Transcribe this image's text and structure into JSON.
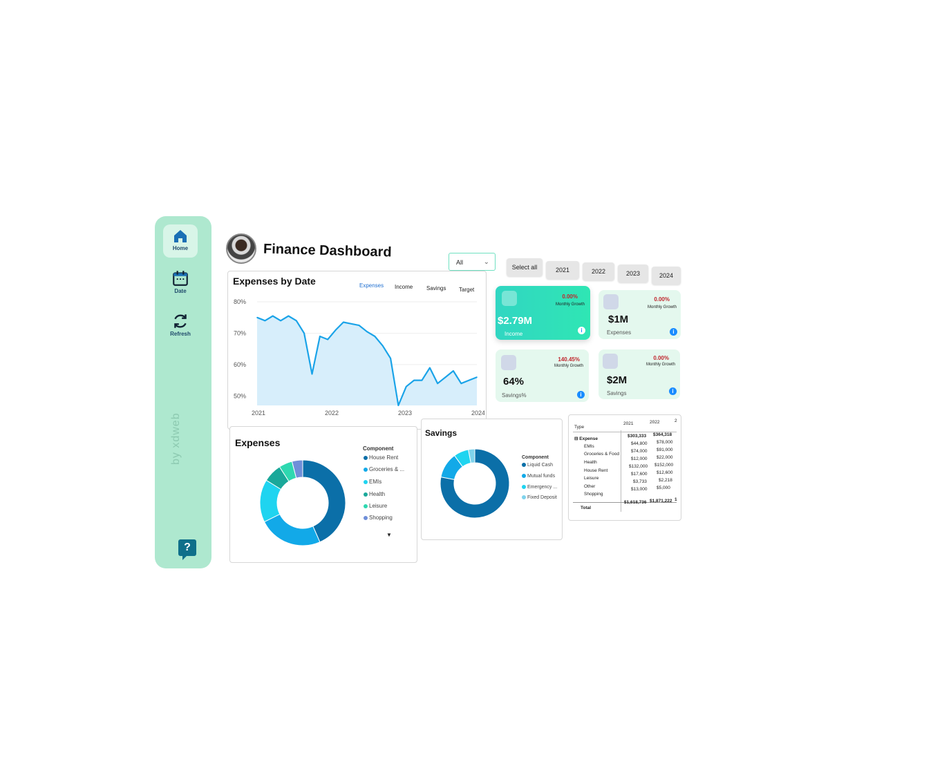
{
  "sidebar": {
    "items": [
      {
        "label": "Home"
      },
      {
        "label": "Date"
      },
      {
        "label": "Refresh"
      }
    ],
    "credit": "by xdweb",
    "help_label": "?"
  },
  "header": {
    "title": "Finance Dashboard",
    "dropdown_value": "All",
    "year_buttons": [
      "Select all",
      "2021",
      "2022",
      "2023",
      "2024"
    ]
  },
  "line_panel": {
    "title": "Expenses by Date",
    "tabs": [
      "Expenses",
      "Income",
      "Savings",
      "Target"
    ]
  },
  "kpis": [
    {
      "value": "$2.79M",
      "label": "Income",
      "growth": "0.00%",
      "growth_label": "Monthly Growth"
    },
    {
      "value": "$1M",
      "label": "Expenses",
      "growth": "0.00%",
      "growth_label": "Monthly Growth"
    },
    {
      "value": "64%",
      "label": "Savings%",
      "growth": "140.45%",
      "growth_label": "Monthly Growth"
    },
    {
      "value": "$2M",
      "label": "Savings",
      "growth": "0.00%",
      "growth_label": "Monthly Growth"
    }
  ],
  "expenses_panel": {
    "title": "Expenses",
    "legend_title": "Component",
    "legend": [
      {
        "name": "House Rent",
        "color": "#0b6fa8"
      },
      {
        "name": "Groceries & ...",
        "color": "#12a9e8"
      },
      {
        "name": "EMIs",
        "color": "#1fd4f0"
      },
      {
        "name": "Health",
        "color": "#1aa89a"
      },
      {
        "name": "Leisure",
        "color": "#2ed8b0"
      },
      {
        "name": "Shopping",
        "color": "#6f8fd9"
      }
    ]
  },
  "savings_panel": {
    "title": "Savings",
    "legend_title": "Component",
    "legend": [
      {
        "name": "Liquid Cash",
        "color": "#0b6fa8"
      },
      {
        "name": "Mutual funds",
        "color": "#12a9e8"
      },
      {
        "name": "Emergency ...",
        "color": "#1fd4f0"
      },
      {
        "name": "Fixed Deposit",
        "color": "#7fd3ec"
      }
    ]
  },
  "table": {
    "header": {
      "type": "Type",
      "y2021": "2021",
      "y2022": "2022",
      "y3": "2"
    },
    "group": "Expense",
    "group_2021": "$303,333",
    "group_2022": "$364,318",
    "rows": [
      {
        "name": "EMIs",
        "v2021": "$44,800",
        "v2022": "$78,000"
      },
      {
        "name": "Groceries & Food",
        "v2021": "$74,000",
        "v2022": "$91,000"
      },
      {
        "name": "Health",
        "v2021": "$12,000",
        "v2022": "$22,000"
      },
      {
        "name": "House Rent",
        "v2021": "$132,000",
        "v2022": "$152,000"
      },
      {
        "name": "Leisure",
        "v2021": "$17,600",
        "v2022": "$12,600"
      },
      {
        "name": "Other",
        "v2021": "$3,733",
        "v2022": "$2,218"
      },
      {
        "name": "Shopping",
        "v2021": "$13,000",
        "v2022": "$5,000"
      }
    ],
    "total_label": "Total",
    "total_2021": "$1,618,736",
    "total_2022": "$1,871,222",
    "total_3": "1"
  },
  "chart_data": [
    {
      "type": "area",
      "title": "Expenses by Date",
      "x_ticks": [
        "2021",
        "2022",
        "2023",
        "2024"
      ],
      "y_ticks": [
        "80%",
        "70%",
        "60%",
        "50%"
      ],
      "ylim": [
        47,
        80
      ],
      "values": [
        75,
        74,
        75.5,
        74,
        75.5,
        74,
        70,
        57,
        69,
        68,
        71,
        73.5,
        73,
        72.5,
        70.5,
        69,
        66,
        62,
        47,
        53,
        55,
        55,
        59,
        54,
        56,
        58,
        54,
        55,
        56
      ],
      "color": "#1aa3e8"
    },
    {
      "type": "pie",
      "title": "Expenses",
      "categories": [
        "House Rent",
        "Groceries & ...",
        "EMIs",
        "Health",
        "Leisure",
        "Shopping"
      ],
      "values": [
        43,
        24,
        16,
        7,
        5,
        4
      ]
    },
    {
      "type": "pie",
      "title": "Savings",
      "categories": [
        "Liquid Cash",
        "Mutual funds",
        "Emergency ...",
        "Fixed Deposit"
      ],
      "values": [
        78,
        12,
        7,
        3
      ]
    }
  ]
}
